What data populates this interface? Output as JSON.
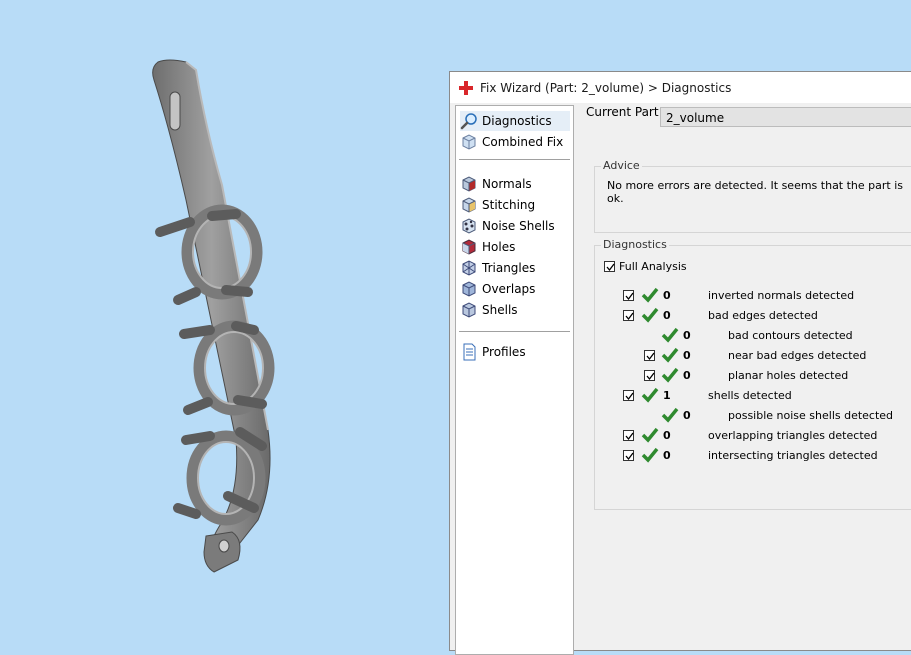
{
  "dialog": {
    "title": "Fix Wizard (Part: 2_volume) > Diagnostics"
  },
  "nav": {
    "items": [
      {
        "label": "Diagnostics",
        "icon": "magnifier-icon",
        "selected": true
      },
      {
        "label": "Combined Fix",
        "icon": "cube-icon"
      },
      {
        "label": "Normals",
        "icon": "normals-cube-icon"
      },
      {
        "label": "Stitching",
        "icon": "stitching-cube-icon"
      },
      {
        "label": "Noise Shells",
        "icon": "noise-shells-icon"
      },
      {
        "label": "Holes",
        "icon": "holes-cube-icon"
      },
      {
        "label": "Triangles",
        "icon": "triangles-cube-icon"
      },
      {
        "label": "Overlaps",
        "icon": "overlaps-cube-icon"
      },
      {
        "label": "Shells",
        "icon": "shells-cube-icon"
      },
      {
        "label": "Profiles",
        "icon": "document-icon"
      }
    ]
  },
  "current_part": {
    "label": "Current Part:",
    "value": "2_volume"
  },
  "advice": {
    "title": "Advice",
    "text": "No more errors are detected. It seems that the part is ok."
  },
  "diagnostics": {
    "title": "Diagnostics",
    "full_analysis_label": "Full Analysis",
    "full_analysis_checked": true,
    "rows": [
      {
        "checkbox": true,
        "count": "0",
        "label": "inverted normals detected",
        "indent": 0
      },
      {
        "checkbox": true,
        "count": "0",
        "label": "bad edges detected",
        "indent": 0
      },
      {
        "checkbox": false,
        "count": "0",
        "label": "bad contours detected",
        "indent": 1
      },
      {
        "checkbox": true,
        "count": "0",
        "label": "near bad edges detected",
        "indent": 1
      },
      {
        "checkbox": true,
        "count": "0",
        "label": "planar holes detected",
        "indent": 1
      },
      {
        "checkbox": true,
        "count": "1",
        "label": "shells detected",
        "indent": 0
      },
      {
        "checkbox": false,
        "count": "0",
        "label": "possible noise shells detected",
        "indent": 1
      },
      {
        "checkbox": true,
        "count": "0",
        "label": "overlapping triangles detected",
        "indent": 0
      },
      {
        "checkbox": true,
        "count": "0",
        "label": "intersecting triangles detected",
        "indent": 0
      }
    ]
  },
  "colors": {
    "background": "#b8dcf7",
    "part": "#8c8c8c",
    "check_green": "#2f8a2f",
    "title_icon_red": "#d9262a"
  }
}
